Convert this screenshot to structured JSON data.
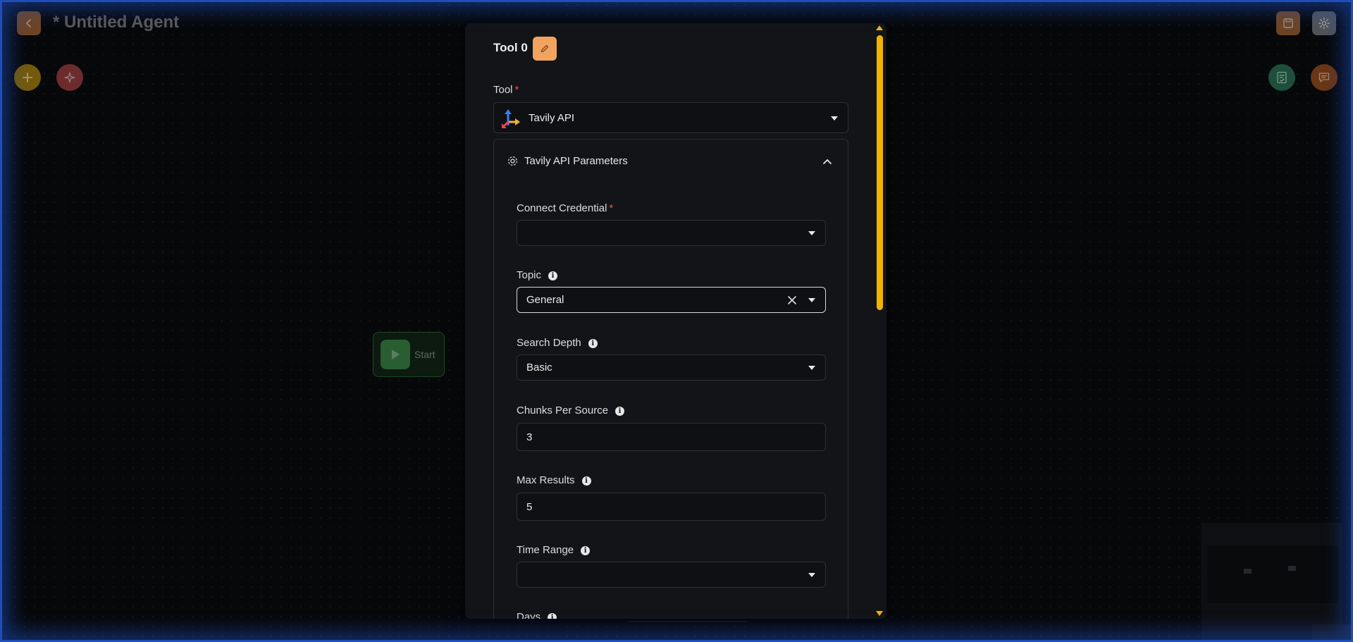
{
  "header": {
    "title": "* Untitled Agent",
    "back_icon": "chevron-left-icon",
    "save_icon": "save-icon",
    "settings_icon": "gear-icon"
  },
  "canvas": {
    "start_node_label": "Start"
  },
  "dialog": {
    "tool_title": "Tool 0",
    "tool_label": "Tool",
    "tool_value": "Tavily API",
    "params_title": "Tavily API Parameters",
    "fields": {
      "credential": {
        "label": "Connect Credential",
        "value": ""
      },
      "topic": {
        "label": "Topic",
        "value": "General"
      },
      "search_depth": {
        "label": "Search Depth",
        "value": "Basic"
      },
      "chunks": {
        "label": "Chunks Per Source",
        "value": "3"
      },
      "max_results": {
        "label": "Max Results",
        "value": "5"
      },
      "time_range": {
        "label": "Time Range",
        "value": ""
      },
      "days": {
        "label": "Days"
      }
    },
    "required_mark": "*",
    "info_glyph": "i"
  },
  "colors": {
    "accent": "#f0b400",
    "edit_button": "#f0a45f",
    "required": "#e05555",
    "frame": "#1e4fb8"
  }
}
